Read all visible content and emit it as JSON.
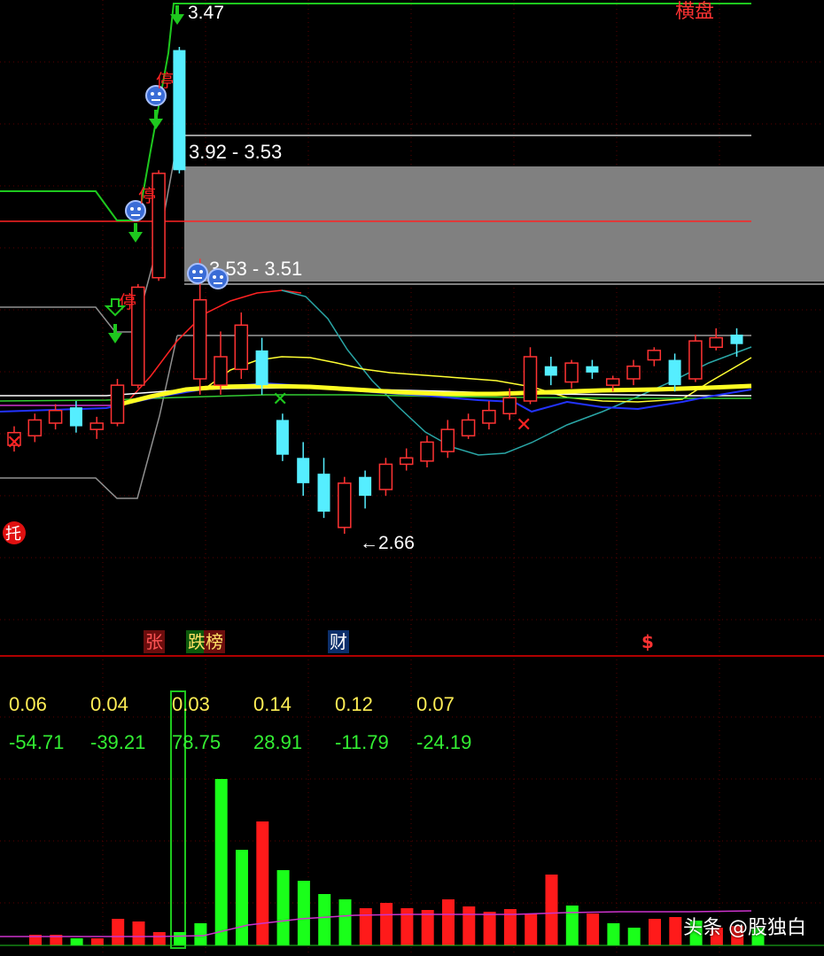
{
  "chart_data": {
    "type": "candlestick",
    "labels": {
      "top_value": "3.47",
      "regime": "横盘",
      "band_upper": "3.92 - 3.53",
      "band_lower": "3.53 - 3.51",
      "low_marker": "←2.66"
    },
    "markers": {
      "stop": "停",
      "tuo": "托",
      "zhang": "张",
      "die_bang": "跌榜",
      "cai": "财",
      "s": "$"
    },
    "candles": [
      {
        "o": 2.94,
        "c": 2.98,
        "h": 3.0,
        "l": 2.92,
        "up": true
      },
      {
        "o": 2.97,
        "c": 3.02,
        "h": 3.04,
        "l": 2.95,
        "up": true
      },
      {
        "o": 3.01,
        "c": 3.05,
        "h": 3.07,
        "l": 2.99,
        "up": true
      },
      {
        "o": 3.06,
        "c": 3.0,
        "h": 3.08,
        "l": 2.98,
        "up": false
      },
      {
        "o": 2.99,
        "c": 3.01,
        "h": 3.03,
        "l": 2.96,
        "up": true
      },
      {
        "o": 3.01,
        "c": 3.13,
        "h": 3.15,
        "l": 3.0,
        "up": true
      },
      {
        "o": 3.13,
        "c": 3.44,
        "h": 3.45,
        "l": 3.12,
        "up": true
      },
      {
        "o": 3.47,
        "c": 3.8,
        "h": 3.81,
        "l": 3.46,
        "up": true
      },
      {
        "o": 3.81,
        "c": 4.19,
        "h": 4.2,
        "l": 3.8,
        "up": false
      },
      {
        "o": 3.4,
        "c": 3.15,
        "h": 3.53,
        "l": 3.1,
        "up": true
      },
      {
        "o": 3.13,
        "c": 3.22,
        "h": 3.3,
        "l": 3.1,
        "up": true
      },
      {
        "o": 3.18,
        "c": 3.32,
        "h": 3.36,
        "l": 3.15,
        "up": true
      },
      {
        "o": 3.24,
        "c": 3.13,
        "h": 3.28,
        "l": 3.1,
        "up": false
      },
      {
        "o": 3.02,
        "c": 2.91,
        "h": 3.04,
        "l": 2.89,
        "up": false
      },
      {
        "o": 2.9,
        "c": 2.82,
        "h": 2.95,
        "l": 2.78,
        "up": false
      },
      {
        "o": 2.85,
        "c": 2.73,
        "h": 2.9,
        "l": 2.71,
        "up": false
      },
      {
        "o": 2.68,
        "c": 2.82,
        "h": 2.84,
        "l": 2.66,
        "up": true
      },
      {
        "o": 2.84,
        "c": 2.78,
        "h": 2.86,
        "l": 2.74,
        "up": false
      },
      {
        "o": 2.8,
        "c": 2.88,
        "h": 2.9,
        "l": 2.78,
        "up": true
      },
      {
        "o": 2.88,
        "c": 2.9,
        "h": 2.93,
        "l": 2.86,
        "up": true
      },
      {
        "o": 2.89,
        "c": 2.95,
        "h": 2.97,
        "l": 2.87,
        "up": true
      },
      {
        "o": 2.92,
        "c": 2.99,
        "h": 3.02,
        "l": 2.9,
        "up": true
      },
      {
        "o": 2.97,
        "c": 3.02,
        "h": 3.04,
        "l": 2.96,
        "up": true
      },
      {
        "o": 3.01,
        "c": 3.05,
        "h": 3.08,
        "l": 2.99,
        "up": true
      },
      {
        "o": 3.04,
        "c": 3.09,
        "h": 3.12,
        "l": 3.02,
        "up": true
      },
      {
        "o": 3.08,
        "c": 3.22,
        "h": 3.25,
        "l": 3.07,
        "up": true
      },
      {
        "o": 3.19,
        "c": 3.16,
        "h": 3.22,
        "l": 3.13,
        "up": false
      },
      {
        "o": 3.14,
        "c": 3.2,
        "h": 3.21,
        "l": 3.12,
        "up": true
      },
      {
        "o": 3.19,
        "c": 3.17,
        "h": 3.21,
        "l": 3.15,
        "up": false
      },
      {
        "o": 3.13,
        "c": 3.15,
        "h": 3.16,
        "l": 3.11,
        "up": true
      },
      {
        "o": 3.15,
        "c": 3.19,
        "h": 3.21,
        "l": 3.13,
        "up": true
      },
      {
        "o": 3.21,
        "c": 3.24,
        "h": 3.25,
        "l": 3.19,
        "up": true
      },
      {
        "o": 3.21,
        "c": 3.13,
        "h": 3.23,
        "l": 3.11,
        "up": false
      },
      {
        "o": 3.15,
        "c": 3.27,
        "h": 3.29,
        "l": 3.14,
        "up": true
      },
      {
        "o": 3.25,
        "c": 3.28,
        "h": 3.31,
        "l": 3.24,
        "up": true
      },
      {
        "o": 3.29,
        "c": 3.26,
        "h": 3.31,
        "l": 3.22,
        "up": false
      }
    ],
    "stats_row_1": [
      "0.06",
      "0.04",
      "0.03",
      "0.14",
      "0.12",
      "0.07"
    ],
    "stats_row_2": [
      "-54.71",
      "-39.21",
      "78.75",
      "28.91",
      "-11.79",
      "-24.19"
    ],
    "volume": [
      {
        "v": 12,
        "up": true
      },
      {
        "v": 12,
        "up": true
      },
      {
        "v": 8,
        "up": false
      },
      {
        "v": 8,
        "up": true
      },
      {
        "v": 30,
        "up": true
      },
      {
        "v": 27,
        "up": true
      },
      {
        "v": 15,
        "up": true
      },
      {
        "v": 15,
        "up": false
      },
      {
        "v": 25,
        "up": false
      },
      {
        "v": 188,
        "up": false
      },
      {
        "v": 108,
        "up": false
      },
      {
        "v": 140,
        "up": true
      },
      {
        "v": 85,
        "up": false
      },
      {
        "v": 73,
        "up": false
      },
      {
        "v": 58,
        "up": false
      },
      {
        "v": 52,
        "up": false
      },
      {
        "v": 42,
        "up": true
      },
      {
        "v": 48,
        "up": true
      },
      {
        "v": 42,
        "up": true
      },
      {
        "v": 40,
        "up": true
      },
      {
        "v": 52,
        "up": true
      },
      {
        "v": 44,
        "up": true
      },
      {
        "v": 38,
        "up": true
      },
      {
        "v": 41,
        "up": true
      },
      {
        "v": 36,
        "up": true
      },
      {
        "v": 80,
        "up": true
      },
      {
        "v": 45,
        "up": false
      },
      {
        "v": 36,
        "up": true
      },
      {
        "v": 25,
        "up": false
      },
      {
        "v": 20,
        "up": false
      },
      {
        "v": 30,
        "up": true
      },
      {
        "v": 32,
        "up": true
      },
      {
        "v": 28,
        "up": false
      },
      {
        "v": 20,
        "up": true
      },
      {
        "v": 22,
        "up": true
      },
      {
        "v": 20,
        "up": false
      }
    ]
  },
  "watermark": "头条 @股独白",
  "colors": {
    "up": "#ff3333",
    "down": "#55eeff",
    "vol_up": "#ff1a1a",
    "vol_down": "#1aff1a",
    "ma_yellow": "#ffff33",
    "ma_white": "#ffffff",
    "ma_teal": "#2aa6a6",
    "ma_red": "#ff2222",
    "ma_blue": "#2233ff",
    "band_fill": "#808080"
  }
}
